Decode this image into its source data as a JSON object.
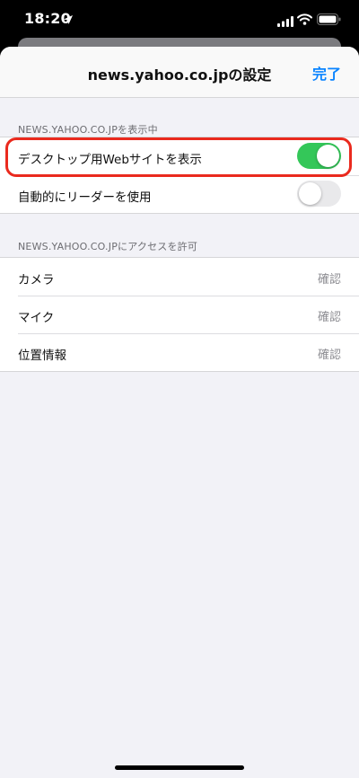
{
  "status_bar": {
    "time": "18:20"
  },
  "sheet": {
    "title": "news.yahoo.co.jpの設定",
    "done_label": "完了"
  },
  "section1": {
    "header": "NEWS.YAHOO.CO.JPを表示中",
    "rows": [
      {
        "label": "デスクトップ用Webサイトを表示",
        "toggle_on": true
      },
      {
        "label": "自動的にリーダーを使用",
        "toggle_on": false
      }
    ]
  },
  "section2": {
    "header": "NEWS.YAHOO.CO.JPにアクセスを許可",
    "rows": [
      {
        "label": "カメラ",
        "value": "確認"
      },
      {
        "label": "マイク",
        "value": "確認"
      },
      {
        "label": "位置情報",
        "value": "確認"
      }
    ]
  },
  "colors": {
    "accent": "#0a84ff",
    "toggle_on": "#34c759",
    "highlight": "#ea2a1e"
  }
}
